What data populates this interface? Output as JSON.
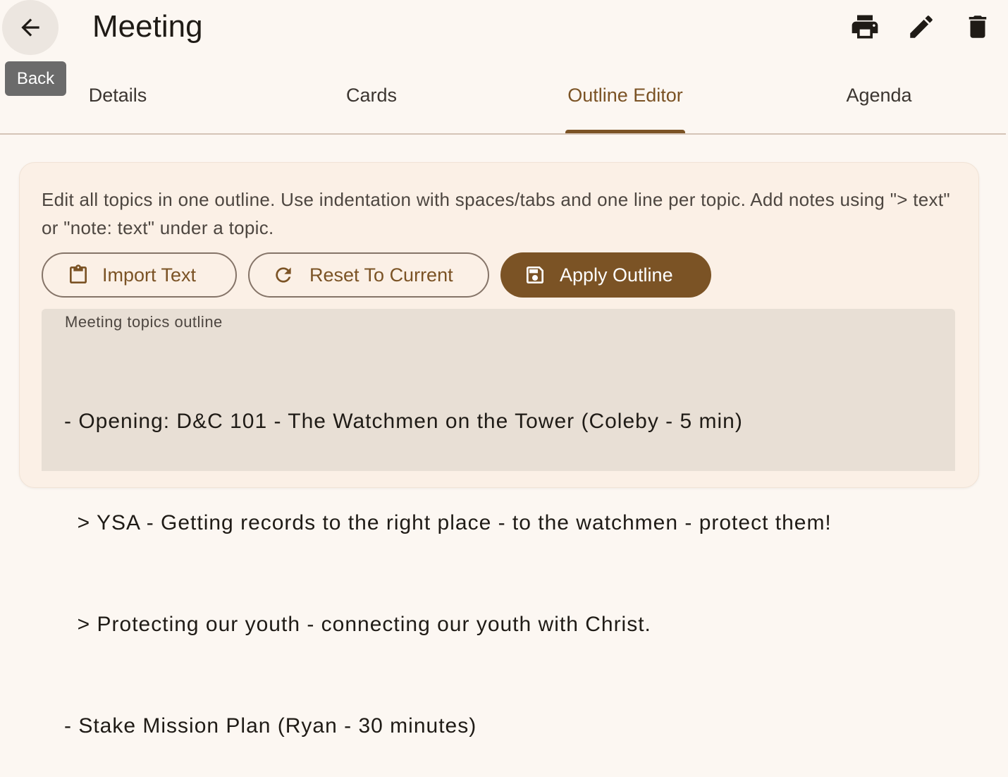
{
  "header": {
    "title": "Meeting",
    "back_tooltip": "Back",
    "icons": [
      "arrow-back-icon",
      "print-icon",
      "edit-icon",
      "delete-icon"
    ]
  },
  "tabs": [
    {
      "label": "Details",
      "active": false
    },
    {
      "label": "Cards",
      "active": false
    },
    {
      "label": "Outline Editor",
      "active": true
    },
    {
      "label": "Agenda",
      "active": false
    }
  ],
  "outline": {
    "help_text": "Edit all topics in one outline. Use indentation with spaces/tabs and one line per topic. Add notes using \"> text\" or \"note: text\" under a topic.",
    "buttons": {
      "import": "Import Text",
      "reset": "Reset To Current",
      "apply": "Apply Outline"
    },
    "field_label": "Meeting topics outline",
    "lines": [
      "- Opening: D&C 101 - The Watchmen on the Tower (Coleby - 5 min)",
      "  > YSA - Getting records to the right place - to the watchmen - protect them!",
      "  > Protecting our youth - connecting our youth with Christ.",
      "- Stake Mission Plan (Ryan - 30 minutes)"
    ]
  },
  "colors": {
    "accent": "#7b5325",
    "background": "#fcf7f2",
    "card": "#fbf0e6",
    "field": "#e8dfd5"
  }
}
